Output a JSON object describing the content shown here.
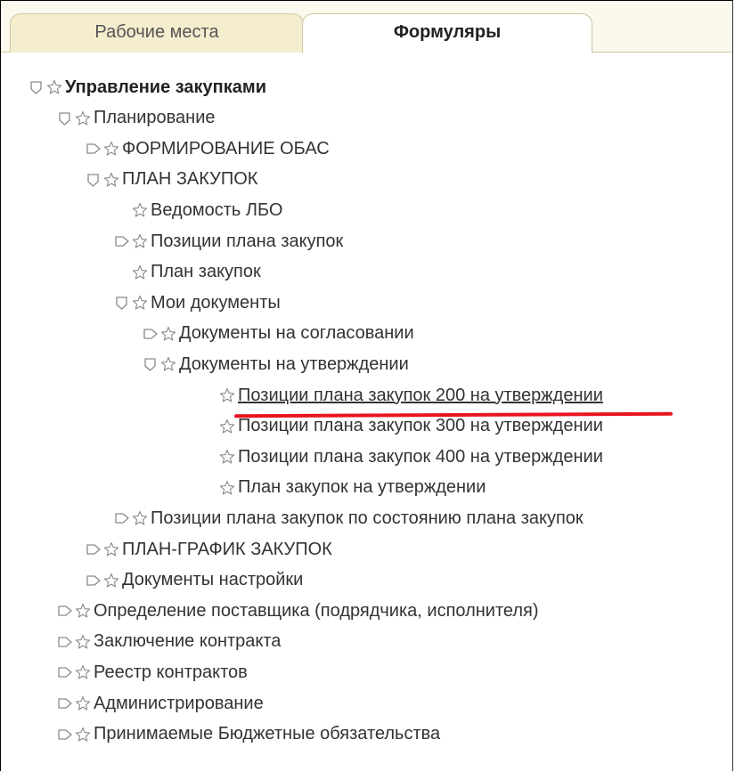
{
  "tabs": [
    {
      "label": "Рабочие места",
      "active": false
    },
    {
      "label": "Формуляры",
      "active": true
    }
  ],
  "tree": [
    {
      "label": "Управление закупками",
      "level": 0,
      "toggle": "expanded",
      "bold": true
    },
    {
      "label": "Планирование",
      "level": 1,
      "toggle": "expanded"
    },
    {
      "label": "ФОРМИРОВАНИЕ ОБАС",
      "level": 2,
      "toggle": "collapsed"
    },
    {
      "label": "ПЛАН ЗАКУПОК",
      "level": 2,
      "toggle": "expanded"
    },
    {
      "label": "Ведомость ЛБО",
      "level": 3,
      "toggle": "none"
    },
    {
      "label": "Позиции плана закупок",
      "level": 3,
      "toggle": "collapsed"
    },
    {
      "label": "План закупок",
      "level": 3,
      "toggle": "none"
    },
    {
      "label": "Мои документы",
      "level": 3,
      "toggle": "expanded"
    },
    {
      "label": "Документы на согласовании",
      "level": 4,
      "toggle": "collapsed"
    },
    {
      "label": "Документы на утверждении",
      "level": 4,
      "toggle": "expanded"
    },
    {
      "label": "Позиции плана закупок 200 на утверждении",
      "level": 5,
      "toggle": "none",
      "underlined": true
    },
    {
      "label": "Позиции плана закупок 300 на утверждении",
      "level": 5,
      "toggle": "none"
    },
    {
      "label": "Позиции плана закупок 400 на утверждении",
      "level": 5,
      "toggle": "none"
    },
    {
      "label": "План закупок на утверждении",
      "level": 5,
      "toggle": "none"
    },
    {
      "label": "Позиции плана закупок по состоянию плана закупок",
      "level": 3,
      "toggle": "collapsed"
    },
    {
      "label": "ПЛАН-ГРАФИК ЗАКУПОК",
      "level": 2,
      "toggle": "collapsed"
    },
    {
      "label": "Документы настройки",
      "level": 2,
      "toggle": "collapsed"
    },
    {
      "label": "Определение поставщика (подрядчика, исполнителя)",
      "level": 1,
      "toggle": "collapsed"
    },
    {
      "label": "Заключение контракта",
      "level": 1,
      "toggle": "collapsed"
    },
    {
      "label": "Реестр контрактов",
      "level": 1,
      "toggle": "collapsed"
    },
    {
      "label": "Администрирование",
      "level": 1,
      "toggle": "collapsed"
    },
    {
      "label": "Принимаемые Бюджетные обязательства",
      "level": 1,
      "toggle": "collapsed"
    }
  ],
  "colors": {
    "tab_bar_bg": "#fbf9ed",
    "inactive_tab_bg": "#f4edce",
    "tab_border": "#cfc8a3",
    "icon_stroke": "#8a8a8a",
    "highlight_underline": "#e8141f"
  },
  "icons": {
    "expanded": "expanded-toggle-icon",
    "collapsed": "collapsed-toggle-icon",
    "favorite": "star-icon"
  }
}
